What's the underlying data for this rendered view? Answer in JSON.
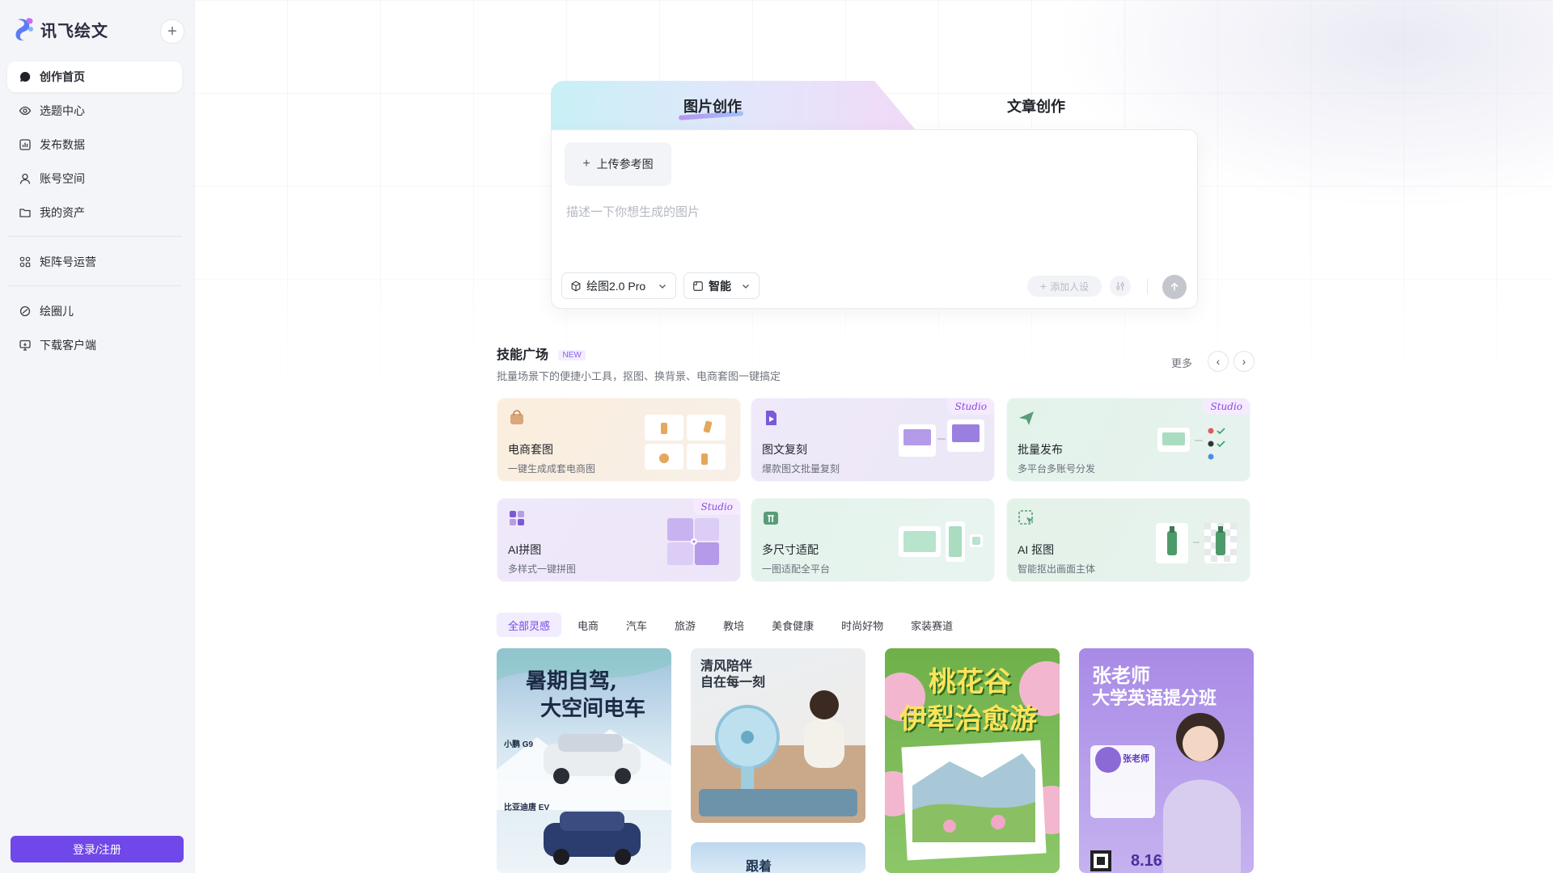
{
  "app": {
    "name": "讯飞绘文"
  },
  "sidebar": {
    "items": [
      {
        "label": "创作首页",
        "icon": "chat-bubble-icon"
      },
      {
        "label": "选题中心",
        "icon": "eye-icon"
      },
      {
        "label": "发布数据",
        "icon": "bar-chart-icon"
      },
      {
        "label": "账号空间",
        "icon": "user-icon"
      },
      {
        "label": "我的资产",
        "icon": "folder-icon"
      }
    ],
    "items2": [
      {
        "label": "矩阵号运营",
        "icon": "grid-nodes-icon"
      }
    ],
    "items3": [
      {
        "label": "绘圈儿",
        "icon": "circle-link-icon"
      },
      {
        "label": "下载客户端",
        "icon": "monitor-download-icon"
      }
    ],
    "login_label": "登录/注册"
  },
  "creator": {
    "tab_image": "图片创作",
    "tab_article": "文章创作",
    "upload_label": "上传参考图",
    "prompt_placeholder": "描述一下你想生成的图片",
    "model_label": "绘图2.0 Pro",
    "ratio_label": "智能",
    "persona_label": "添加人设"
  },
  "skills": {
    "title": "技能广场",
    "badge": "NEW",
    "subtitle": "批量场景下的便捷小工具，抠图、换背景、电商套图一键搞定",
    "more_label": "更多",
    "cards": [
      {
        "title": "电商套图",
        "desc": "一键生成成套电商图",
        "studio": ""
      },
      {
        "title": "图文复刻",
        "desc": "爆款图文批量复刻",
        "studio": "Studio"
      },
      {
        "title": "批量发布",
        "desc": "多平台多账号分发",
        "studio": "Studio"
      },
      {
        "title": "AI拼图",
        "desc": "多样式一键拼图",
        "studio": "Studio"
      },
      {
        "title": "多尺寸适配",
        "desc": "一图适配全平台",
        "studio": ""
      },
      {
        "title": "AI 抠图",
        "desc": "智能抠出画面主体",
        "studio": ""
      }
    ]
  },
  "filters": [
    "全部灵感",
    "电商",
    "汽车",
    "旅游",
    "教培",
    "美食健康",
    "时尚好物",
    "家装赛道"
  ],
  "gallery": {
    "p1": {
      "line1": "暑期自驾,",
      "line2": "大空间电车",
      "car1": "小鹏 G9",
      "car2": "比亚迪唐 EV"
    },
    "p2": {
      "line1": "清风陪伴",
      "line2": "自在每一刻"
    },
    "p3": {
      "line1": "桃花谷",
      "line2": "伊犁治愈游"
    },
    "p4": {
      "line1": "张老师",
      "line2": "大学英语提分班",
      "name": "张老师",
      "date": "8.16"
    },
    "p5": {
      "line1": "跟着"
    }
  },
  "colors": {
    "accent": "#7047e8"
  }
}
